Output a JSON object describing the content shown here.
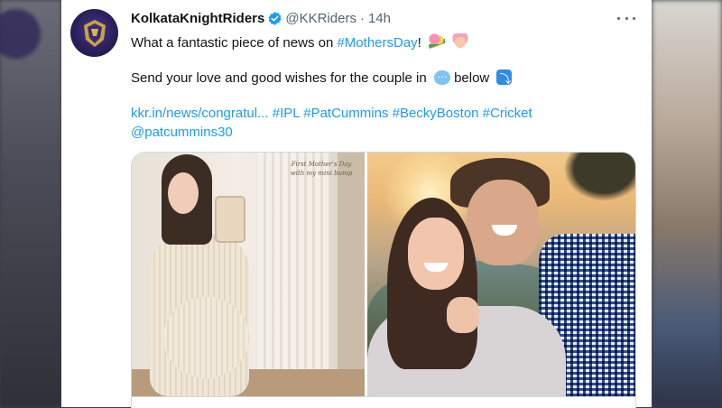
{
  "tweet": {
    "author_name": "KolkataKnightRiders",
    "handle": "@KKRiders",
    "separator": "·",
    "time": "14h",
    "line1_prefix": "What a fantastic piece of news on ",
    "line1_hashtag": "#MothersDay",
    "line1_suffix": "!",
    "line2_prefix": "Send your love and good wishes for the couple in",
    "line2_suffix": "below",
    "link_url": "kkr.in/news/congratul...",
    "hashtags": [
      "#IPL",
      "#PatCummins",
      "#BeckyBoston",
      "#Cricket"
    ],
    "mention": "@patcummins30",
    "photo_caption": "First Mother's Day with my mini bump"
  },
  "icons": {
    "verified": "verified-badge-icon",
    "more": "more-options-icon",
    "emoji_bouquet": "bouquet-emoji",
    "emoji_baby": "baby-emoji",
    "emoji_speech": "speech-balloon-emoji",
    "emoji_return": "arrow-down-return-emoji"
  },
  "colors": {
    "link": "#1d9bf0",
    "text": "#0f1419",
    "secondary": "#536471",
    "verified": "#1d9bf0"
  }
}
